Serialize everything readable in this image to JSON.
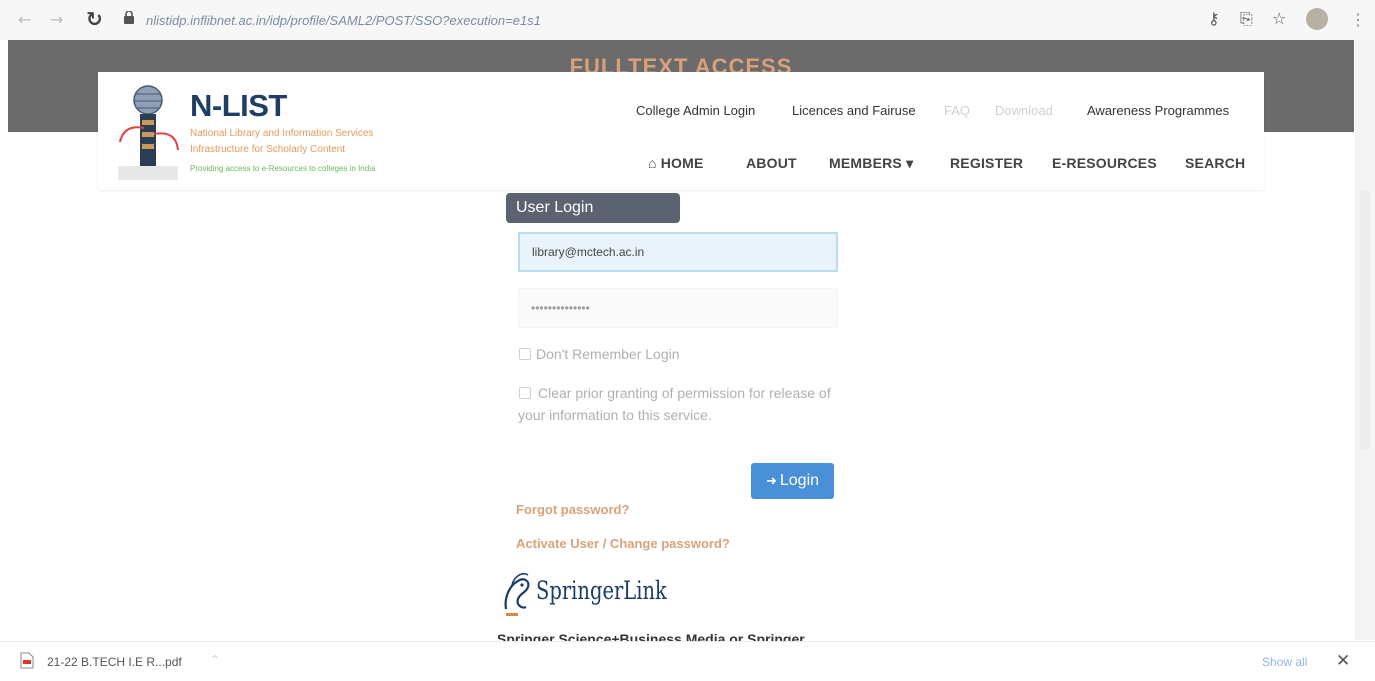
{
  "browser": {
    "url": "nlistidp.inflibnet.ac.in/idp/profile/SAML2/POST/SSO?execution=e1s1",
    "back_icon": "back-arrow-icon",
    "forward_icon": "forward-arrow-icon",
    "reload_icon": "reload-icon",
    "lock_icon": "lock-icon",
    "toolbar_icons": [
      "key-icon",
      "share-icon",
      "star-icon"
    ]
  },
  "banner": {
    "title": "FULLTEXT ACCESS"
  },
  "header": {
    "logo_title": "N-LIST",
    "logo_sub1": "National Library and Information Services",
    "logo_sub2": "Infrastructure for Scholarly Content",
    "logo_sub3": "Providing access to e-Resources to colleges in India",
    "top_links": [
      "College Admin Login",
      "Licences and Fairuse",
      "FAQ",
      "Download",
      "Awareness Programmes"
    ],
    "nav": {
      "home": "HOME",
      "about": "ABOUT",
      "members": "MEMBERS",
      "register": "REGISTER",
      "eresources": "E-RESOURCES",
      "search": "SEARCH"
    }
  },
  "login": {
    "heading": "User Login",
    "username_value": "library@mctech.ac.in",
    "password_value": "••••••••••••••",
    "dont_remember": "Don't Remember Login",
    "clear_consent": "Clear prior granting of permission for release of your information to this service.",
    "login_button": "Login",
    "forgot_password": "Forgot password?",
    "activate_user": "Activate User / Change password?"
  },
  "springer": {
    "logo_text": "SpringerLink",
    "caption": "Springer Science+Business Media or Springer"
  },
  "download_bar": {
    "file_name": "21-22 B.TECH I.E R...pdf",
    "show_all": "Show all",
    "close_glyph": "✕"
  },
  "colors": {
    "banner_bg": "#6b6b6b",
    "banner_title": "#d9a07a",
    "logo_blue": "#1f3e64",
    "login_head_bg": "#5b6270",
    "login_button_bg": "#4a90d9",
    "link_color": "#d9a27a"
  }
}
